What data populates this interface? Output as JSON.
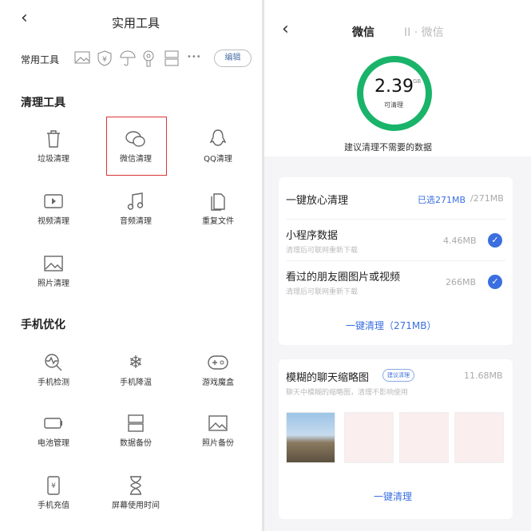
{
  "left": {
    "back": "‹",
    "title": "实用工具",
    "common_label": "常用工具",
    "common_icons": [
      "image-icon",
      "shield-yen-icon",
      "umbrella-icon",
      "key-icon",
      "storage-icon"
    ],
    "more": "•••",
    "edit": "编辑",
    "clean_heading": "清理工具",
    "clean_tools": [
      {
        "label": "垃圾清理"
      },
      {
        "label": "微信清理"
      },
      {
        "label": "QQ清理"
      },
      {
        "label": "视频清理"
      },
      {
        "label": "音频清理"
      },
      {
        "label": "重复文件"
      },
      {
        "label": "照片清理"
      }
    ],
    "opt_heading": "手机优化",
    "opt_tools": [
      {
        "label": "手机检测"
      },
      {
        "label": "手机降温"
      },
      {
        "label": "游戏魔盒"
      },
      {
        "label": "电池管理"
      },
      {
        "label": "数据备份"
      },
      {
        "label": "照片备份"
      },
      {
        "label": "手机充值"
      },
      {
        "label": "屏幕使用时间"
      }
    ]
  },
  "right": {
    "back": "‹",
    "tab_active": "微信",
    "tab_inactive": "II · 微信",
    "ring_value": "2.39",
    "ring_unit": "GB",
    "ring_label": "可清理",
    "suggest": "建议清理不需要的数据",
    "card1": {
      "title": "一键放心清理",
      "selected": "已选271MB",
      "total": "/271MB",
      "items": [
        {
          "name": "小程序数据",
          "sub": "清理后可联网重新下载",
          "size": "4.46MB",
          "checked": true
        },
        {
          "name": "看过的朋友圈图片或视频",
          "sub": "清理后可联网重新下载",
          "size": "266MB",
          "checked": true
        }
      ],
      "button": "一键清理（271MB）"
    },
    "card2": {
      "title": "模糊的聊天缩略图",
      "badge": "建议清理",
      "size": "11.68MB",
      "sub": "聊天中模糊的缩略图，清理不影响使用",
      "button": "一键清理"
    },
    "colors": {
      "ring": "#19b46a",
      "accent": "#3b6fe0"
    }
  }
}
